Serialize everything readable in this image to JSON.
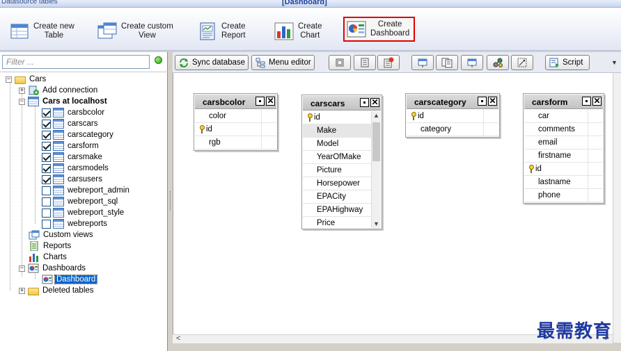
{
  "window": {
    "left_title": "Datasource tables",
    "center_title": "[Dashboard]"
  },
  "ribbon": {
    "buttons": [
      {
        "label": "Create new\nTable",
        "icon": "new-table-icon"
      },
      {
        "label": "Create custom\nView",
        "icon": "custom-view-icon"
      },
      {
        "label": "Create\nReport",
        "icon": "report-icon"
      },
      {
        "label": "Create\nChart",
        "icon": "chart-icon"
      },
      {
        "label": "Create\nDashboard",
        "icon": "dashboard-icon",
        "selected": true
      }
    ]
  },
  "filter": {
    "placeholder": "Filter ...",
    "value": ""
  },
  "tree": {
    "root": "Cars",
    "add_connection": "Add connection",
    "connection": "Cars at localhost",
    "tables": [
      {
        "name": "carsbcolor",
        "checked": true
      },
      {
        "name": "carscars",
        "checked": true
      },
      {
        "name": "carscategory",
        "checked": true
      },
      {
        "name": "carsform",
        "checked": true
      },
      {
        "name": "carsmake",
        "checked": true
      },
      {
        "name": "carsmodels",
        "checked": true
      },
      {
        "name": "carsusers",
        "checked": true
      },
      {
        "name": "webreport_admin",
        "checked": false
      },
      {
        "name": "webreport_sql",
        "checked": false
      },
      {
        "name": "webreport_style",
        "checked": false
      },
      {
        "name": "webreports",
        "checked": false
      }
    ],
    "custom_views": "Custom views",
    "reports": "Reports",
    "charts": "Charts",
    "dashboards": "Dashboards",
    "dashboard_item": "Dashboard",
    "deleted_tables": "Deleted tables"
  },
  "diagram_toolbar": {
    "sync": "Sync database",
    "menu_editor": "Menu editor",
    "script": "Script"
  },
  "diagram_tables": [
    {
      "title": "carsbcolor",
      "fields": [
        {
          "name": "color",
          "key": false
        },
        {
          "name": "id",
          "key": true
        },
        {
          "name": "rgb",
          "key": false
        }
      ]
    },
    {
      "title": "carscars",
      "fields": [
        {
          "name": "id",
          "key": true
        },
        {
          "name": "Make",
          "key": false,
          "selected": true
        },
        {
          "name": "Model",
          "key": false
        },
        {
          "name": "YearOfMake",
          "key": false
        },
        {
          "name": "Picture",
          "key": false
        },
        {
          "name": "Horsepower",
          "key": false
        },
        {
          "name": "EPACity",
          "key": false
        },
        {
          "name": "EPAHighway",
          "key": false
        },
        {
          "name": "Price",
          "key": false
        }
      ]
    },
    {
      "title": "carscategory",
      "fields": [
        {
          "name": "id",
          "key": true
        },
        {
          "name": "category",
          "key": false
        }
      ]
    },
    {
      "title": "carsform",
      "fields": [
        {
          "name": "car",
          "key": false
        },
        {
          "name": "comments",
          "key": false
        },
        {
          "name": "email",
          "key": false
        },
        {
          "name": "firstname",
          "key": false
        },
        {
          "name": "id",
          "key": true
        },
        {
          "name": "lastname",
          "key": false
        },
        {
          "name": "phone",
          "key": false
        }
      ]
    }
  ],
  "watermark": "最需教育"
}
